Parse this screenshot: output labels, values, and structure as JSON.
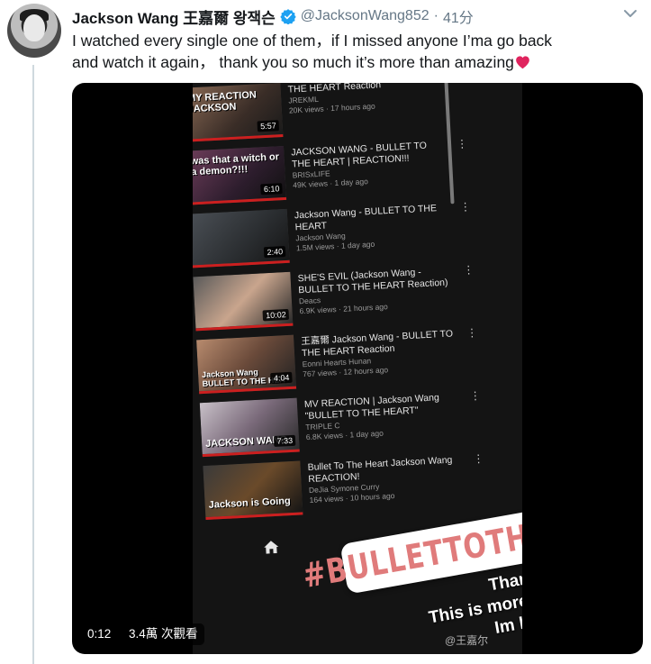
{
  "tweet": {
    "author_name": "Jackson Wang 王嘉爾 왕잭슨",
    "handle": "@JacksonWang852",
    "separator": "·",
    "time": "41分",
    "text_line1": "I watched every single one of them，if I missed anyone I’ma go back",
    "text_line2": "and watch it again，  thank you so much it’s more than amazing",
    "icons": {
      "verified": "verified-badge-icon",
      "menu": "chevron-down-icon",
      "emoji": "red-heart-emoji"
    },
    "colors": {
      "verified": "#1da1f2",
      "heart": "#e0245e",
      "secondary_text": "#657786"
    }
  },
  "video": {
    "duration": "0:12",
    "views": "3.4萬 次觀看",
    "feed": [
      {
        "title": "THE HEART Reaction",
        "channel": "JREKML",
        "stats": "20K views · 17 hours ago",
        "thumb_caption": "MY REACTION JACKSON",
        "duration": "5:57"
      },
      {
        "title": "JACKSON WANG - BULLET TO THE HEART | REACTION!!!",
        "channel": "BRISxLIFE",
        "stats": "49K views · 1 day ago",
        "thumb_caption": "was that a witch or a demon?!!!",
        "duration": "6:10"
      },
      {
        "title": "Jackson Wang - BULLET TO THE HEART",
        "channel": "Jackson Wang",
        "stats": "1.5M views · 1 day ago",
        "thumb_caption": "",
        "duration": "2:40"
      },
      {
        "title": "SHE'S EVIL (Jackson Wang - BULLET TO THE HEART Reaction)",
        "channel": "Deacs",
        "stats": "6.9K views · 21 hours ago",
        "thumb_caption": "",
        "duration": "10:02"
      },
      {
        "title": "王嘉爾 Jackson Wang - BULLET TO THE HEART Reaction",
        "channel": "Eonni Hearts Hunan",
        "stats": "767 views · 12 hours ago",
        "thumb_caption": "Jackson Wang BULLET TO THE HEA",
        "duration": "4:04"
      },
      {
        "title": "MV REACTION | Jackson Wang \"BULLET TO THE HEART\"",
        "channel": "TRIPLE C",
        "stats": "6.8K views · 1 day ago",
        "thumb_caption": "JACKSON WANG",
        "duration": "7:33"
      },
      {
        "title": "Bullet To The Heart Jackson Wang REACTION!",
        "channel": "DeJia Symone Curry",
        "stats": "164 views · 10 hours ago",
        "thumb_caption": "Jackson is Going",
        "duration": ""
      }
    ],
    "story": {
      "hashtag": "#BULLETTOTHEHEART",
      "message_line1": "Thank you",
      "message_line2": "This is more than amazing",
      "message_line3": "Im blessed",
      "watermark": "@王嘉尔"
    }
  }
}
